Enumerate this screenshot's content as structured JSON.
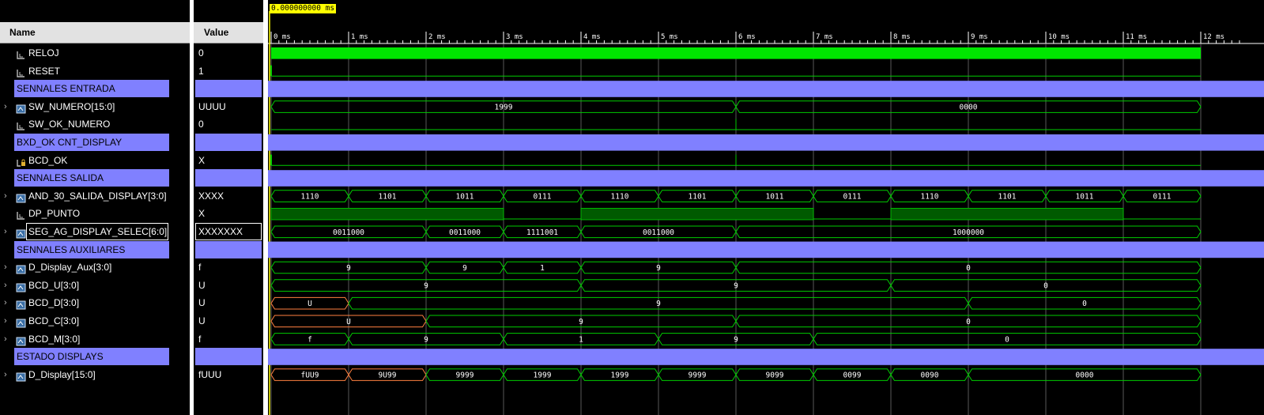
{
  "headers": {
    "name": "Name",
    "value": "Value"
  },
  "cursor_time": "0.000000000 ms",
  "time_ticks": [
    "0 ms",
    "1 ms",
    "2 ms",
    "3 ms",
    "4 ms",
    "5 ms",
    "6 ms",
    "7 ms",
    "8 ms",
    "9 ms",
    "10 ms",
    "11 ms",
    "12 ms"
  ],
  "colors": {
    "group_bg": "#8080ff",
    "clock": "#00e600",
    "dp_high": "#005a00",
    "bus_line": "#00cc00",
    "bus_undefined": "#ff8040",
    "cursor": "#ffff00"
  },
  "signals": [
    {
      "name": "RELOJ",
      "value": "0",
      "kind": "bit",
      "icon": "signal-icon"
    },
    {
      "name": "RESET",
      "value": "1",
      "kind": "bit",
      "icon": "signal-icon"
    },
    {
      "name": "SENNALES ENTRADA",
      "value": "",
      "kind": "group"
    },
    {
      "name": "SW_NUMERO[15:0]",
      "value": "UUUU",
      "kind": "bus",
      "icon": "bus-icon",
      "segments": [
        {
          "t0": 0,
          "t1": 6,
          "label": "1999"
        },
        {
          "t0": 6,
          "t1": 12,
          "label": "0000"
        }
      ]
    },
    {
      "name": "SW_OK_NUMERO",
      "value": "0",
      "kind": "bit",
      "icon": "signal-icon"
    },
    {
      "name": "BXD_OK CNT_DISPLAY",
      "value": "",
      "kind": "group"
    },
    {
      "name": "BCD_OK",
      "value": "X",
      "kind": "bit",
      "icon": "locked-signal-icon"
    },
    {
      "name": "SENNALES SALIDA",
      "value": "",
      "kind": "group"
    },
    {
      "name": "AND_30_SALIDA_DISPLAY[3:0]",
      "value": "XXXX",
      "kind": "bus",
      "icon": "bus-icon",
      "segments": [
        {
          "t0": 0,
          "t1": 1,
          "label": "1110"
        },
        {
          "t0": 1,
          "t1": 2,
          "label": "1101"
        },
        {
          "t0": 2,
          "t1": 3,
          "label": "1011"
        },
        {
          "t0": 3,
          "t1": 4,
          "label": "0111"
        },
        {
          "t0": 4,
          "t1": 5,
          "label": "1110"
        },
        {
          "t0": 5,
          "t1": 6,
          "label": "1101"
        },
        {
          "t0": 6,
          "t1": 7,
          "label": "1011"
        },
        {
          "t0": 7,
          "t1": 8,
          "label": "0111"
        },
        {
          "t0": 8,
          "t1": 9,
          "label": "1110"
        },
        {
          "t0": 9,
          "t1": 10,
          "label": "1101"
        },
        {
          "t0": 10,
          "t1": 11,
          "label": "1011"
        },
        {
          "t0": 11,
          "t1": 12,
          "label": "0111"
        }
      ]
    },
    {
      "name": "DP_PUNTO",
      "value": "X",
      "kind": "dp",
      "icon": "signal-icon",
      "high": [
        [
          0,
          3
        ],
        [
          4,
          7
        ],
        [
          8,
          11
        ]
      ]
    },
    {
      "name": "SEG_AG_DISPLAY_SELEC[6:0]",
      "value": "XXXXXXX",
      "kind": "bus",
      "icon": "bus-icon",
      "selected": true,
      "segments": [
        {
          "t0": 0,
          "t1": 2,
          "label": "0011000"
        },
        {
          "t0": 2,
          "t1": 3,
          "label": "0011000"
        },
        {
          "t0": 3,
          "t1": 4,
          "label": "1111001"
        },
        {
          "t0": 4,
          "t1": 6,
          "label": "0011000"
        },
        {
          "t0": 6,
          "t1": 12,
          "label": "1000000"
        }
      ]
    },
    {
      "name": "SENNALES AUXILIARES",
      "value": "",
      "kind": "group"
    },
    {
      "name": "D_Display_Aux[3:0]",
      "value": "f",
      "kind": "bus",
      "icon": "bus-icon",
      "segments": [
        {
          "t0": 0,
          "t1": 2,
          "label": "9"
        },
        {
          "t0": 2,
          "t1": 3,
          "label": "9"
        },
        {
          "t0": 3,
          "t1": 4,
          "label": "1"
        },
        {
          "t0": 4,
          "t1": 6,
          "label": "9"
        },
        {
          "t0": 6,
          "t1": 12,
          "label": "0"
        }
      ]
    },
    {
      "name": "BCD_U[3:0]",
      "value": "U",
      "kind": "bus",
      "icon": "bus-icon",
      "segments": [
        {
          "t0": 0,
          "t1": 4,
          "label": "9"
        },
        {
          "t0": 4,
          "t1": 8,
          "label": "9"
        },
        {
          "t0": 8,
          "t1": 12,
          "label": "0"
        }
      ]
    },
    {
      "name": "BCD_D[3:0]",
      "value": "U",
      "kind": "bus",
      "icon": "bus-icon",
      "segments": [
        {
          "t0": 0,
          "t1": 1,
          "label": "U",
          "undef": true
        },
        {
          "t0": 1,
          "t1": 9,
          "label": "9"
        },
        {
          "t0": 9,
          "t1": 12,
          "label": "0"
        }
      ]
    },
    {
      "name": "BCD_C[3:0]",
      "value": "U",
      "kind": "bus",
      "icon": "bus-icon",
      "segments": [
        {
          "t0": 0,
          "t1": 2,
          "label": "U",
          "undef": true
        },
        {
          "t0": 2,
          "t1": 6,
          "label": "9"
        },
        {
          "t0": 6,
          "t1": 12,
          "label": "0"
        }
      ]
    },
    {
      "name": "BCD_M[3:0]",
      "value": "f",
      "kind": "bus",
      "icon": "bus-icon",
      "segments": [
        {
          "t0": 0,
          "t1": 1,
          "label": "f"
        },
        {
          "t0": 1,
          "t1": 3,
          "label": "9"
        },
        {
          "t0": 3,
          "t1": 5,
          "label": "1"
        },
        {
          "t0": 5,
          "t1": 7,
          "label": "9"
        },
        {
          "t0": 7,
          "t1": 12,
          "label": "0"
        }
      ]
    },
    {
      "name": "ESTADO DISPLAYS",
      "value": "",
      "kind": "group"
    },
    {
      "name": "D_Display[15:0]",
      "value": "fUUU",
      "kind": "bus",
      "icon": "bus-icon",
      "segments": [
        {
          "t0": 0,
          "t1": 1,
          "label": "fUU9",
          "undef": true
        },
        {
          "t0": 1,
          "t1": 2,
          "label": "9U99",
          "undef": true
        },
        {
          "t0": 2,
          "t1": 3,
          "label": "9999"
        },
        {
          "t0": 3,
          "t1": 4,
          "label": "1999"
        },
        {
          "t0": 4,
          "t1": 5,
          "label": "1999"
        },
        {
          "t0": 5,
          "t1": 6,
          "label": "9999"
        },
        {
          "t0": 6,
          "t1": 7,
          "label": "9099"
        },
        {
          "t0": 7,
          "t1": 8,
          "label": "0099"
        },
        {
          "t0": 8,
          "t1": 9,
          "label": "0090"
        },
        {
          "t0": 9,
          "t1": 12,
          "label": "0000"
        }
      ]
    }
  ]
}
